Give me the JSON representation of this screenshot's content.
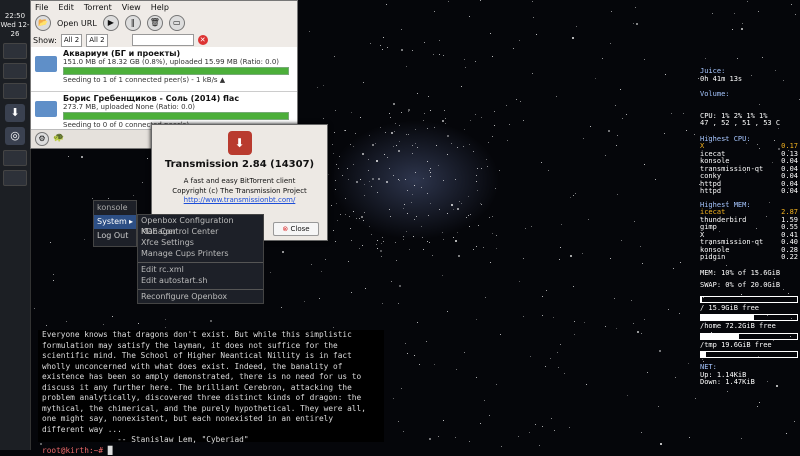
{
  "panel": {
    "time": "22:50",
    "date": "Wed 12-26"
  },
  "transmission": {
    "menu": [
      "File",
      "Edit",
      "Torrent",
      "View",
      "Help"
    ],
    "open_url_label": "Open URL",
    "show_label": "Show:",
    "filter1": {
      "value": "All",
      "count": "2"
    },
    "filter2": {
      "value": "All",
      "count": "2"
    },
    "torrents": [
      {
        "name": "Аквариум (БГ и проекты)",
        "info": "151.0 MB of 18.32 GB (0.8%), uploaded 15.99 MB (Ratio: 0.0)",
        "status": "Seeding to 1 of 1 connected peer(s) - 1 kB/s ▲",
        "progress": 1.0
      },
      {
        "name": "Борис Гребенщиков - Соль (2014) flac",
        "info": "273.7 MB, uploaded None (Ratio: 0.0)",
        "status": "Seeding to 0 of 0 connected peer(s)",
        "progress": 1.0
      }
    ]
  },
  "about": {
    "title": "Transmission 2.84 (14307)",
    "line1": "A fast and easy BitTorrent client",
    "line2": "Copyright (c) The Transmission Project",
    "link": "http://www.transmissionbt.com/",
    "close_label": "Close"
  },
  "openbox_menu": {
    "header": "konsole",
    "items": [
      "System",
      "Log Out"
    ],
    "submenu": [
      "Openbox Configuration Manager",
      "KDE Control Center",
      "Xfce Settings",
      "Manage Cups Printers",
      "Edit rc.xml",
      "Edit autostart.sh",
      "Reconfigure Openbox"
    ]
  },
  "terminal": {
    "lines": [
      "Everyone knows that dragons don't exist.  But while this simplistic",
      "formulation may satisfy the layman, it does not suffice for the",
      "scientific mind.  The School of Higher Neantical Nillity is in fact",
      "wholly unconcerned with what does exist.  Indeed, the banality of",
      "existence has been so amply demonstrated, there is no need for us to",
      "discuss it any further here.  The brilliant Cerebron, attacking the",
      "problem analytically, discovered three distinct kinds of dragon: the",
      "mythical, the chimerical, and the purely hypothetical.  They were all,",
      "one might say, nonexistent, but each nonexisted in an entirely",
      "different way ...",
      "                -- Stanislaw Lem, \"Cyberiad\""
    ],
    "prompt": "root@kirth:~#"
  },
  "conky": {
    "juice_label": "Juice:",
    "juice_value": "0h 41m 13s",
    "volume_label": "Volume:",
    "cpu_line1": "CPU: 1% 2% 1% 1%",
    "cpu_line2": "47 , 52 , 51 , 53  C",
    "highest_cpu_label": "Highest CPU:",
    "highest_cpu": [
      {
        "name": "X",
        "val": "0.17"
      },
      {
        "name": "icecat",
        "val": "0.13"
      },
      {
        "name": "konsole",
        "val": "0.04"
      },
      {
        "name": "transmission-qt",
        "val": "0.04"
      },
      {
        "name": "conky",
        "val": "0.04"
      },
      {
        "name": "httpd",
        "val": "0.04"
      },
      {
        "name": "httpd",
        "val": "0.04"
      }
    ],
    "highest_mem_label": "Highest MEM:",
    "highest_mem": [
      {
        "name": "icecat",
        "val": "2.87"
      },
      {
        "name": "thunderbird",
        "val": "1.59"
      },
      {
        "name": "gimp",
        "val": "0.55"
      },
      {
        "name": "X",
        "val": "0.41"
      },
      {
        "name": "transmission-qt",
        "val": "0.40"
      },
      {
        "name": "konsole",
        "val": "0.28"
      },
      {
        "name": "pidgin",
        "val": "0.22"
      }
    ],
    "mem_line": "MEM:    10% of 15.6GiB",
    "swap_line": "SWAP: 0% of 20.0GiB",
    "root_line": "/     15.9GiB free",
    "home_line": "/home  72.2GiB free",
    "tmp_line": "/tmp  19.6GiB free",
    "net_label": "NET:",
    "up_line": "Up: 1.14KiB",
    "down_line": "Down: 1.47KiB",
    "colors": {
      "label": "#a6c6ff",
      "highlight": "#f3b21f"
    }
  }
}
